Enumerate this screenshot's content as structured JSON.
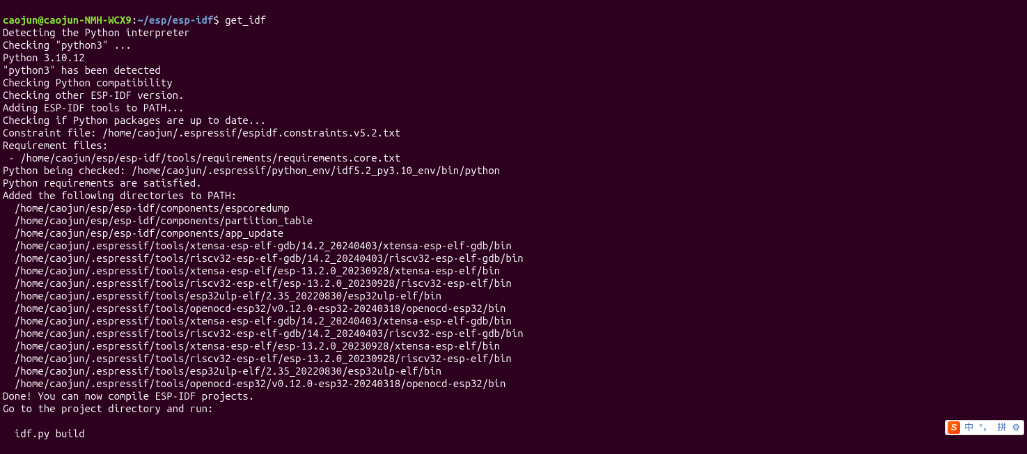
{
  "prompt": {
    "user": "caojun@caojun-NMH-WCX9",
    "sep1": ":",
    "path": "~/esp/esp-idf",
    "dollar": "$ ",
    "command": "get_idf"
  },
  "lines": [
    "Detecting the Python interpreter",
    "Checking \"python3\" ...",
    "Python 3.10.12",
    "\"python3\" has been detected",
    "Checking Python compatibility",
    "Checking other ESP-IDF version.",
    "Adding ESP-IDF tools to PATH...",
    "Checking if Python packages are up to date...",
    "Constraint file: /home/caojun/.espressif/espidf.constraints.v5.2.txt",
    "Requirement files:",
    " - /home/caojun/esp/esp-idf/tools/requirements/requirements.core.txt",
    "Python being checked: /home/caojun/.espressif/python_env/idf5.2_py3.10_env/bin/python",
    "Python requirements are satisfied.",
    "Added the following directories to PATH:",
    "  /home/caojun/esp/esp-idf/components/espcoredump",
    "  /home/caojun/esp/esp-idf/components/partition_table",
    "  /home/caojun/esp/esp-idf/components/app_update",
    "  /home/caojun/.espressif/tools/xtensa-esp-elf-gdb/14.2_20240403/xtensa-esp-elf-gdb/bin",
    "  /home/caojun/.espressif/tools/riscv32-esp-elf-gdb/14.2_20240403/riscv32-esp-elf-gdb/bin",
    "  /home/caojun/.espressif/tools/xtensa-esp-elf/esp-13.2.0_20230928/xtensa-esp-elf/bin",
    "  /home/caojun/.espressif/tools/riscv32-esp-elf/esp-13.2.0_20230928/riscv32-esp-elf/bin",
    "  /home/caojun/.espressif/tools/esp32ulp-elf/2.35_20220830/esp32ulp-elf/bin",
    "  /home/caojun/.espressif/tools/openocd-esp32/v0.12.0-esp32-20240318/openocd-esp32/bin",
    "  /home/caojun/.espressif/tools/xtensa-esp-elf-gdb/14.2_20240403/xtensa-esp-elf-gdb/bin",
    "  /home/caojun/.espressif/tools/riscv32-esp-elf-gdb/14.2_20240403/riscv32-esp-elf-gdb/bin",
    "  /home/caojun/.espressif/tools/xtensa-esp-elf/esp-13.2.0_20230928/xtensa-esp-elf/bin",
    "  /home/caojun/.espressif/tools/riscv32-esp-elf/esp-13.2.0_20230928/riscv32-esp-elf/bin",
    "  /home/caojun/.espressif/tools/esp32ulp-elf/2.35_20220830/esp32ulp-elf/bin",
    "  /home/caojun/.espressif/tools/openocd-esp32/v0.12.0-esp32-20240318/openocd-esp32/bin",
    "Done! You can now compile ESP-IDF projects.",
    "Go to the project directory and run:",
    "",
    "  idf.py build"
  ],
  "ime": {
    "logo": "S",
    "lang": "中",
    "punct": "°，",
    "mode": "拼",
    "gear": "⚙"
  }
}
